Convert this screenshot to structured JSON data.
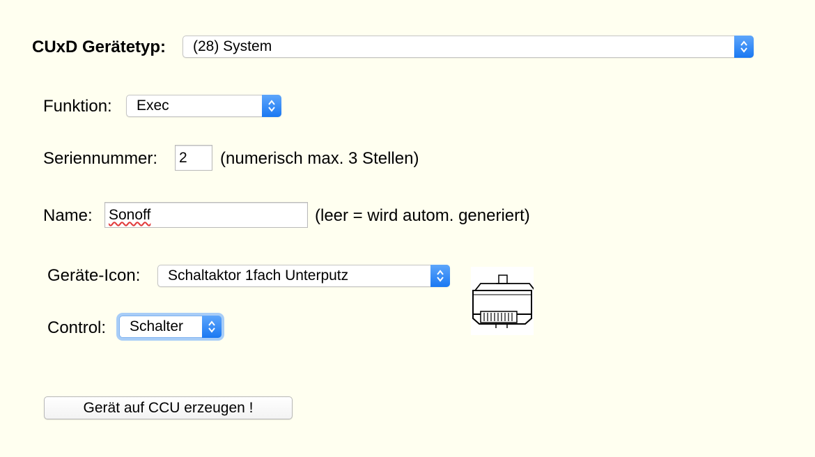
{
  "device_type": {
    "label": "CUxD Gerätetyp:",
    "value": "(28) System"
  },
  "function": {
    "label": "Funktion:",
    "value": "Exec"
  },
  "serial": {
    "label": "Seriennummer:",
    "value": "2",
    "hint": "(numerisch max. 3 Stellen)"
  },
  "name": {
    "label": "Name:",
    "value": "Sonoff",
    "hint": "(leer = wird autom. generiert)"
  },
  "icon": {
    "label": "Geräte-Icon:",
    "value": "Schaltaktor 1fach Unterputz",
    "image": "flush-mount-switch-actuator-icon"
  },
  "control": {
    "label": "Control:",
    "value": "Schalter"
  },
  "create_button": {
    "label": "Gerät auf CCU erzeugen !"
  },
  "colors": {
    "background": "#fffff0",
    "accent": "#1a78f2",
    "focus": "#a8cdf7"
  }
}
